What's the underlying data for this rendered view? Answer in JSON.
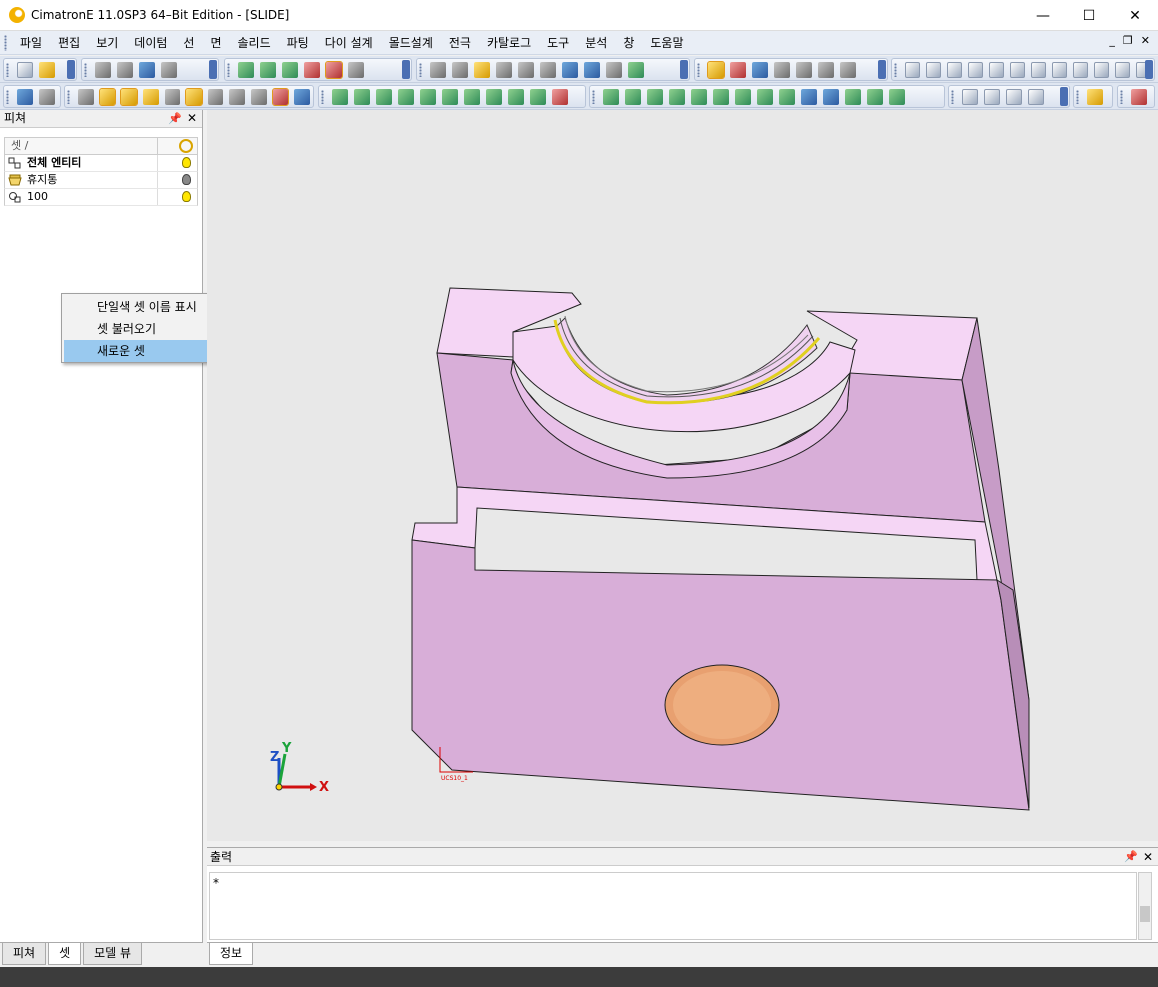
{
  "window": {
    "title": "CimatronE 11.0SP3 64–Bit Edition - [SLIDE]",
    "minimize": "—",
    "maximize": "☐",
    "close": "✕"
  },
  "menubar": {
    "items": [
      "파일",
      "편집",
      "보기",
      "데이텀",
      "선",
      "면",
      "솔리드",
      "파팅",
      "다이 설계",
      "몰드설계",
      "전극",
      "카탈로그",
      "도구",
      "분석",
      "창",
      "도움말"
    ],
    "mdi_min": "_",
    "mdi_restore": "❐",
    "mdi_close": "✕"
  },
  "feature_panel": {
    "title": "피쳐",
    "pin": "📌",
    "close": "✕",
    "column_header": "셋 /",
    "sets": [
      {
        "name": "전체 엔티티",
        "bold": true,
        "visible": true
      },
      {
        "name": "휴지통",
        "bold": false,
        "visible": false
      },
      {
        "name": "100",
        "bold": false,
        "visible": true
      }
    ]
  },
  "context_menu": {
    "items": [
      "단일색 셋 이름 표시",
      "셋 불러오기",
      "새로운 셋"
    ],
    "active_index": 2
  },
  "viewport": {
    "axis_labels": {
      "z": "Z",
      "y": "Y",
      "x": "X"
    },
    "ucs_label": "UCS10_1",
    "colors": {
      "background": "#e8e8e8",
      "part_face": "#d8aed8",
      "part_top": "#f5d6f5",
      "hole": "#e8a070",
      "ring": "#e0d020"
    }
  },
  "output_panel": {
    "title": "출력",
    "content": "*"
  },
  "bottom_tabs": {
    "left": [
      "피쳐",
      "셋",
      "모델 뷰"
    ],
    "right": [
      "정보"
    ]
  }
}
